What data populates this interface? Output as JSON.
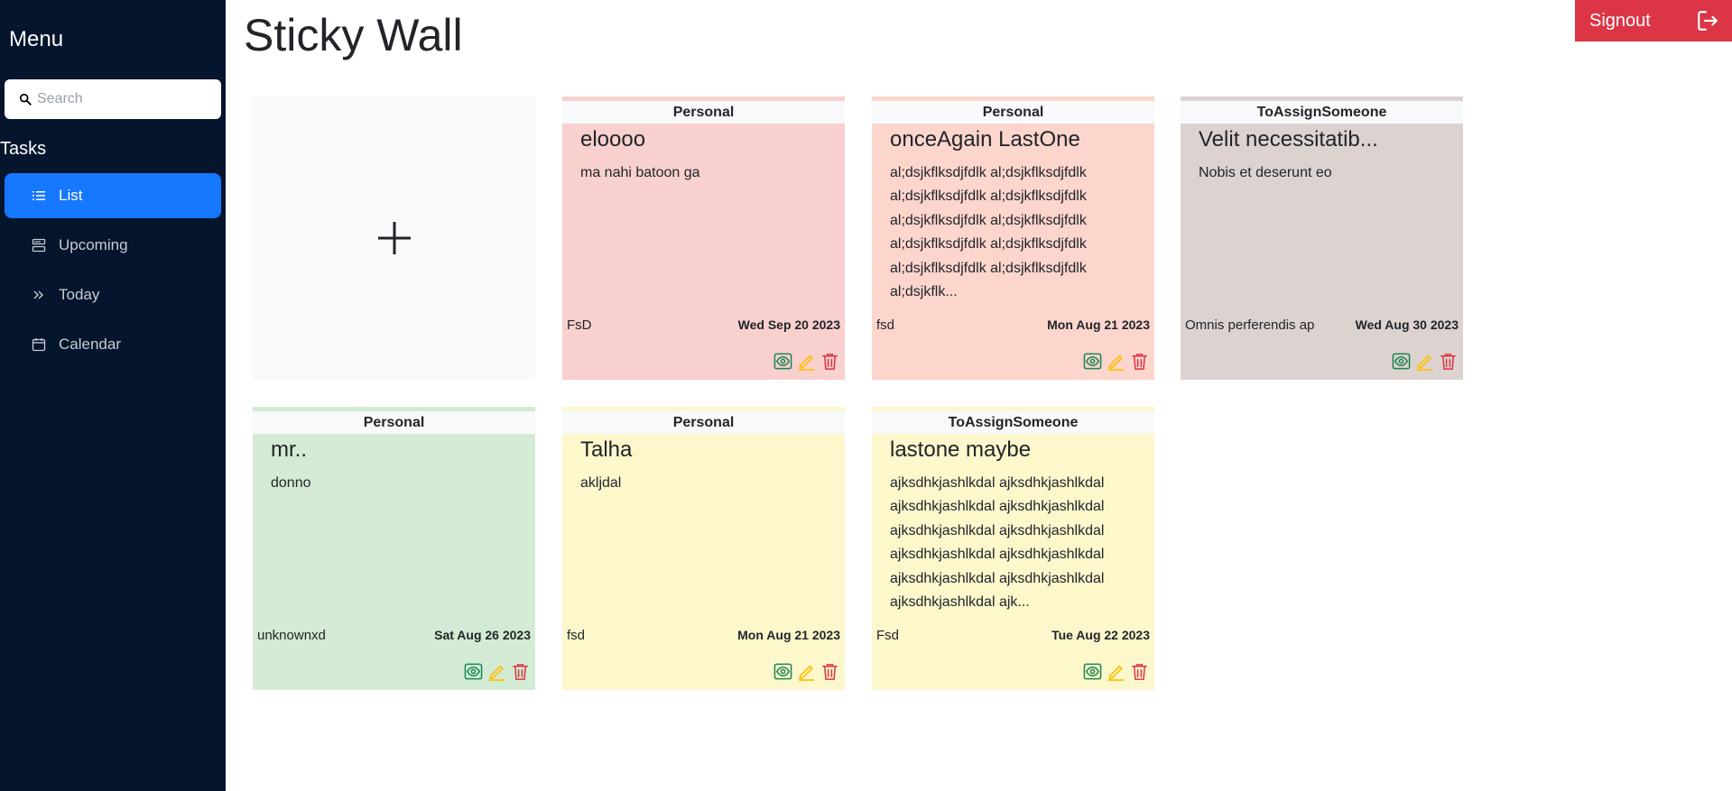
{
  "sidebar": {
    "menu_title": "Menu",
    "search_placeholder": "Search",
    "tasks_title": "Tasks",
    "items": [
      {
        "label": "List",
        "icon": "list-icon",
        "active": true
      },
      {
        "label": "Upcoming",
        "icon": "upcoming-icon",
        "active": false
      },
      {
        "label": "Today",
        "icon": "double-chevron-right-icon",
        "active": false
      },
      {
        "label": "Calendar",
        "icon": "calendar-icon",
        "active": false
      }
    ]
  },
  "header": {
    "title": "Sticky Wall",
    "signout_label": "Signout"
  },
  "add_card": {
    "icon": "plus-icon"
  },
  "notes": [
    {
      "category": "Personal",
      "title": "eloooo",
      "body": "ma nahi batoon ga",
      "assignee": "FsD",
      "date": "Wed Sep 20 2023",
      "bg": "#f8d0ce",
      "bar": "#f8d0ce"
    },
    {
      "category": "Personal",
      "title": "onceAgain LastOne",
      "body": "al;dsjkflksdjfdlk al;dsjkflksdjfdlk al;dsjkflksdjfdlk al;dsjkflksdjfdlk al;dsjkflksdjfdlk al;dsjkflksdjfdlk al;dsjkflksdjfdlk al;dsjkflksdjfdlk al;dsjkflksdjfdlk al;dsjkflksdjfdlk al;dsjkflk...",
      "assignee": "fsd",
      "date": "Mon Aug 21 2023",
      "bg": "#fcd5cc",
      "bar": "#fcd5cc"
    },
    {
      "category": "ToAssignSomeone",
      "title": "Velit necessitatib...",
      "body": "Nobis et deserunt eo",
      "assignee": "Omnis perferendis ap",
      "date": "Wed Aug 30 2023",
      "bg": "#dcd2cf",
      "bar": "#dcd2cf"
    },
    {
      "category": "Personal",
      "title": "mr..",
      "body": "donno",
      "assignee": "unknownxd",
      "date": "Sat Aug 26 2023",
      "bg": "#d3ebd4",
      "bar": "#d3ebd4"
    },
    {
      "category": "Personal",
      "title": "Talha",
      "body": "akljdal",
      "assignee": "fsd",
      "date": "Mon Aug 21 2023",
      "bg": "#fdf7cc",
      "bar": "#fdf7cc"
    },
    {
      "category": "ToAssignSomeone",
      "title": "lastone maybe",
      "body": "ajksdhkjashlkdal ajksdhkjashlkdal ajksdhkjashlkdal ajksdhkjashlkdal ajksdhkjashlkdal ajksdhkjashlkdal ajksdhkjashlkdal ajksdhkjashlkdal ajksdhkjashlkdal ajksdhkjashlkdal ajksdhkjashlkdal ajk...",
      "assignee": "Fsd",
      "date": "Tue Aug 22 2023",
      "bg": "#fdf7cc",
      "bar": "#fdf7cc"
    }
  ],
  "colors": {
    "sidebar_bg": "#04152d",
    "active_nav": "#1677ff",
    "signout_bg": "#dc3545",
    "view_icon": "#198754",
    "edit_icon": "#ffc107",
    "delete_icon": "#dc3545"
  }
}
